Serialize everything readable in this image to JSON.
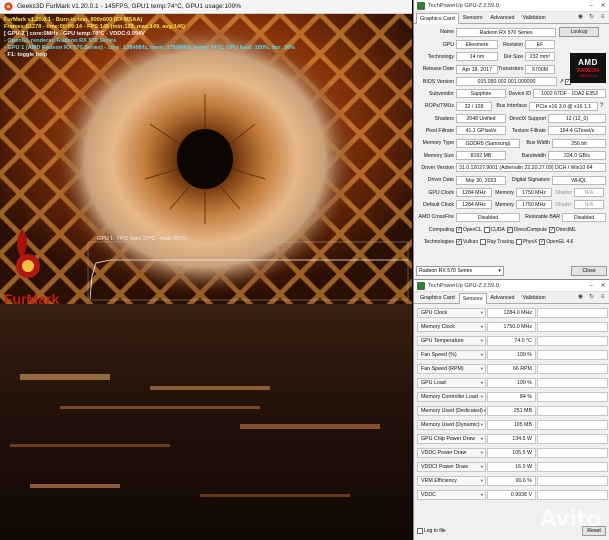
{
  "furmark": {
    "window_title": "Geeks3D FurMark v1.20.0.1 - 145FPS, GPU1 temp:74°C, GPU1 usage:100%",
    "osd": [
      {
        "text": "FurMark v1.20.0.1 - Burn-in test, 800x600 (0X MSAA)",
        "color": "y"
      },
      {
        "text": "Frames:81278 - time:00:09:14 - FPS:145 (min:129, max:149, avg:146)",
        "color": "y"
      },
      {
        "text": "[ GPU-Z ] core:0MHz - GPU temp:74°C - VDDC:0.994V",
        "color": "w"
      },
      {
        "text": "- OpenGL renderer: Radeon RX 570 Series",
        "color": "c"
      },
      {
        "text": "- GPU 1 (AMD Radeon RX 570 Series) - core: 1284MHz, mem: 1750MHz, temp: 74°C, GPU load: 100%, fan: 38%",
        "color": "c"
      },
      {
        "text": "- F1: toggle help",
        "color": "w"
      }
    ],
    "temp_graph_label": "GPU 1: 74°C (min: 27°C - max: 75°C)",
    "logo_text": "FurMark"
  },
  "gpuz_card": {
    "title": "TechPowerUp GPU-Z 2.59.0",
    "tabs": [
      "Graphics Card",
      "Sensors",
      "Advanced",
      "Validation"
    ],
    "lookup_label": "Lookup",
    "fields": {
      "name": {
        "label": "Name",
        "value": "Radeon RX 570 Series"
      },
      "gpu": {
        "label": "GPU",
        "value": "Ellesmere"
      },
      "revision": {
        "label": "Revision",
        "value": "EF"
      },
      "technology": {
        "label": "Technology",
        "value": "14 nm"
      },
      "die_size": {
        "label": "Die Size",
        "value": "232 mm²"
      },
      "release_date": {
        "label": "Release Date",
        "value": "Apr 18, 2017"
      },
      "transistors": {
        "label": "Transistors",
        "value": "5700M"
      },
      "bios_version": {
        "label": "BIOS Version",
        "value": "015.050.002.001.000000"
      },
      "uefi": {
        "label": "UEFI"
      },
      "subvendor": {
        "label": "Subvendor",
        "value": "Sapphire"
      },
      "device_id": {
        "label": "Device ID",
        "value": "1002 67DF - 1DA2 E353"
      },
      "rops_tmus": {
        "label": "ROPs/TMUs",
        "value": "32 / 128"
      },
      "bus_interface": {
        "label": "Bus Interface",
        "value": "PCIe x16 3.0 @ x16 1.1"
      },
      "shaders": {
        "label": "Shaders",
        "value": "2048 Unified"
      },
      "directx": {
        "label": "DirectX Support",
        "value": "12 (12_0)"
      },
      "pixel_fillrate": {
        "label": "Pixel Fillrate",
        "value": "41.1 GPixel/s"
      },
      "texture_fillrate": {
        "label": "Texture Fillrate",
        "value": "164.4 GTexel/s"
      },
      "memory_type": {
        "label": "Memory Type",
        "value": "GDDR5 (Samsung)"
      },
      "bus_width": {
        "label": "Bus Width",
        "value": "256 bit"
      },
      "memory_size": {
        "label": "Memory Size",
        "value": "8192 MB"
      },
      "bandwidth": {
        "label": "Bandwidth",
        "value": "224.0 GB/s"
      },
      "driver_version": {
        "label": "Driver Version",
        "value": "31.0.12027.9001 (Adrenalin 22.20.27.09) DCH / Win10 64"
      },
      "driver_date": {
        "label": "Driver Date",
        "value": "Mar 30, 2023"
      },
      "digital_signature": {
        "label": "Digital Signature",
        "value": "WHQL"
      },
      "gpu_clock": {
        "label": "GPU Clock",
        "value": "1284 MHz"
      },
      "memory_clock": {
        "label": "Memory",
        "value": "1750 MHz"
      },
      "shader_clock": {
        "label": "Shader",
        "value": "N/A"
      },
      "default_clock": {
        "label": "Default Clock",
        "value": "1284 MHz"
      },
      "default_memory": {
        "label": "Memory",
        "value": "1750 MHz"
      },
      "default_shader": {
        "label": "Shader",
        "value": "N/A"
      },
      "crossfire": {
        "label": "AMD CrossFire",
        "value": "Disabled"
      },
      "resizable_bar": {
        "label": "Resizable BAR",
        "value": "Disabled"
      }
    },
    "computing": {
      "label": "Computing",
      "items": [
        {
          "name": "OpenCL",
          "checked": "✓"
        },
        {
          "name": "CUDA",
          "checked": ""
        },
        {
          "name": "DirectCompute",
          "checked": "✓"
        },
        {
          "name": "DirectML",
          "checked": "✓"
        }
      ]
    },
    "technologies": {
      "label": "Technologies",
      "items": [
        {
          "name": "Vulkan",
          "checked": "✓"
        },
        {
          "name": "Ray Tracing",
          "checked": ""
        },
        {
          "name": "PhysX",
          "checked": ""
        },
        {
          "name": "OpenGL 4.6",
          "checked": "✓"
        }
      ]
    },
    "selected_gpu": "Radeon RX 570 Series",
    "close_label": "Close",
    "amd_logo": {
      "brand": "AMD",
      "line2": "RADEON",
      "line3": "GRAPHICS"
    }
  },
  "gpuz_sensors": {
    "title": "TechPowerUp GPU-Z 2.59.0",
    "tabs": [
      "Graphics Card",
      "Sensors",
      "Advanced",
      "Validation"
    ],
    "sensors": [
      {
        "name": "GPU Clock",
        "value": "1284.0 MHz",
        "level": 0.95
      },
      {
        "name": "Memory Clock",
        "value": "1750.0 MHz",
        "level": 0.95
      },
      {
        "name": "GPU Temperature",
        "value": "74.0 °C",
        "level": 0.7
      },
      {
        "name": "Fan Speed (%)",
        "value": "100 %",
        "level": 0.5
      },
      {
        "name": "Fan Speed (RPM)",
        "value": "66 RPM",
        "level": 0.2
      },
      {
        "name": "GPU Load",
        "value": "100 %",
        "level": 0.9
      },
      {
        "name": "Memory Controller Load",
        "value": "84 %",
        "level": 0.7
      },
      {
        "name": "Memory Used (Dedicated)",
        "value": "251 MB",
        "level": 0.15
      },
      {
        "name": "Memory Used (Dynamic)",
        "value": "105 MB",
        "level": 0.1
      },
      {
        "name": "GPU Chip Power Draw",
        "value": "134.5 W",
        "level": 0.8
      },
      {
        "name": "VDDC Power Draw",
        "value": "105.5 W",
        "level": 0.75
      },
      {
        "name": "VDDCI Power Draw",
        "value": "16.0 W",
        "level": 0.4
      },
      {
        "name": "VRM Efficiency",
        "value": "90.6 %",
        "level": 0.85
      },
      {
        "name": "VDDC",
        "value": "0.9938 V",
        "level": 0.55
      }
    ],
    "log_to_file": "Log to file",
    "reset_label": "Reset"
  },
  "watermark": "Avito"
}
